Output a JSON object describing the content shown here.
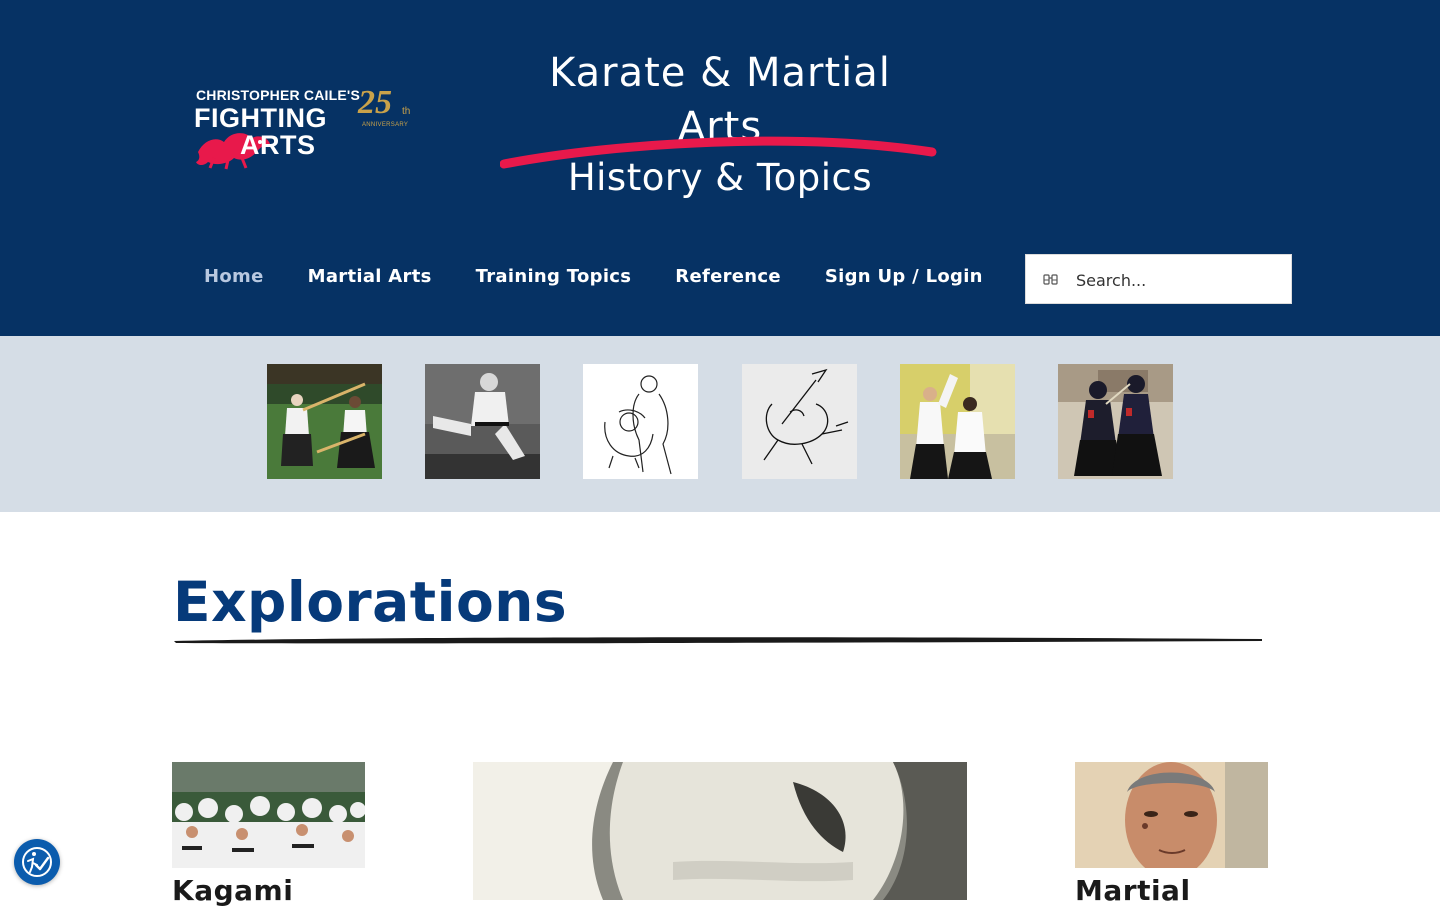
{
  "logo": {
    "line1": "CHRISTOPHER CAILE'S",
    "line2": "FIGHTING",
    "line3": "ARTS",
    "anniversary_number": "25",
    "anniversary_suffix": "th",
    "anniversary_label": "ANNIVERSARY"
  },
  "hero": {
    "title_line1": "Karate & Martial",
    "title_line2": "Arts",
    "subtitle": "History & Topics"
  },
  "nav": {
    "items": [
      {
        "label": "Home",
        "active": true
      },
      {
        "label": "Martial Arts",
        "active": false
      },
      {
        "label": "Training Topics",
        "active": false
      },
      {
        "label": "Reference",
        "active": false
      },
      {
        "label": "Sign Up / Login",
        "active": false
      }
    ]
  },
  "search": {
    "placeholder": "Search..."
  },
  "thumbnails": [
    {
      "name": "aikido-bokken-outdoor-photo"
    },
    {
      "name": "flying-kick-photo"
    },
    {
      "name": "grappling-line-drawing"
    },
    {
      "name": "sword-warrior-sketch"
    },
    {
      "name": "aikido-dojo-photo"
    },
    {
      "name": "kendo-match-photo"
    }
  ],
  "section": {
    "title": "Explorations"
  },
  "cards": [
    {
      "title": "Kagami",
      "image": "dojo-crowd-photo"
    },
    {
      "title": "",
      "image": "karate-gi-closeup-photo"
    },
    {
      "title": "Martial",
      "image": "master-portrait-photo"
    }
  ],
  "colors": {
    "header_bg": "#063264",
    "strip_bg": "#d5dde6",
    "accent_red": "#e8194b",
    "title_blue": "#063a7a",
    "gold": "#c9a24a",
    "a11y_button": "#0b5cad"
  }
}
